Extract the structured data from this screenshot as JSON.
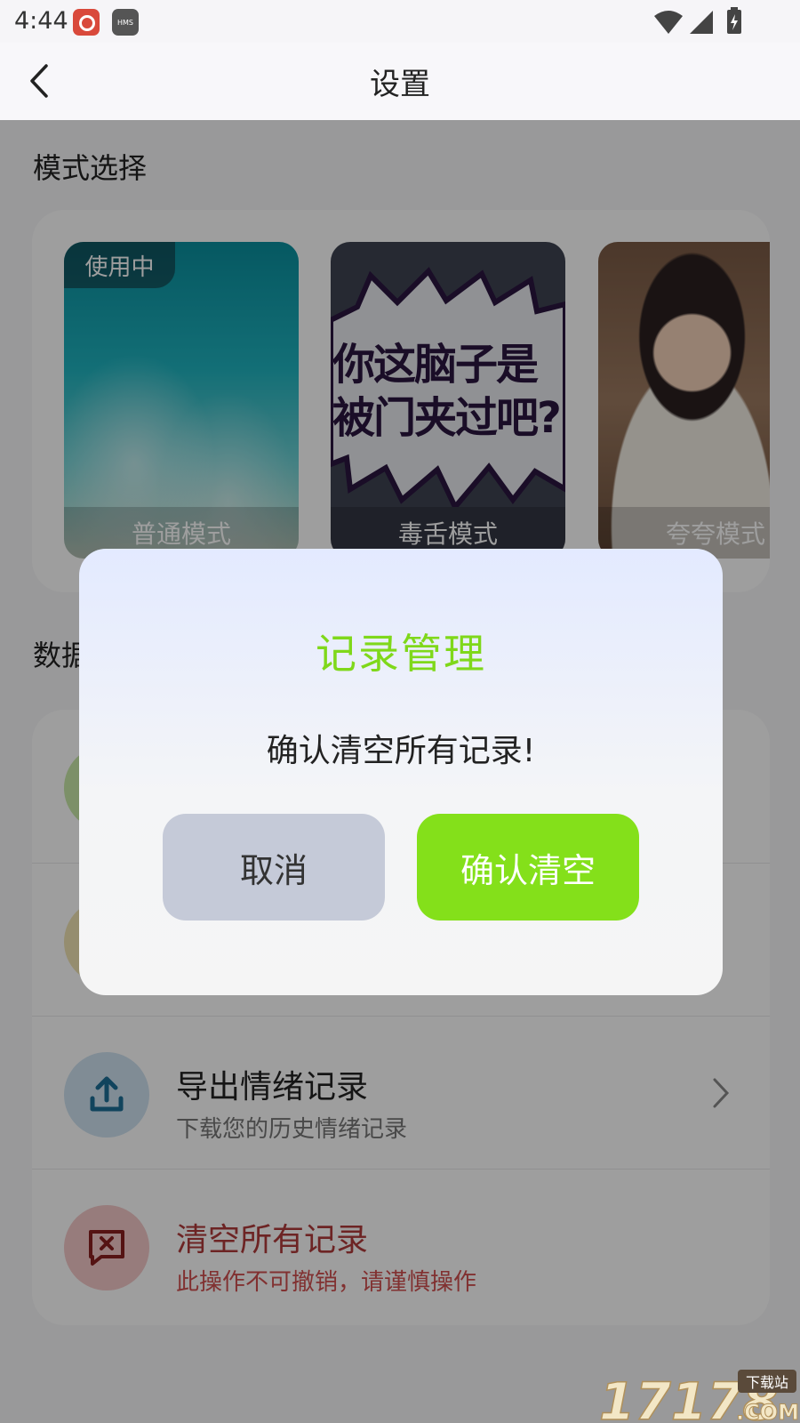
{
  "status_bar": {
    "time": "4:44",
    "app_badge": "HMS"
  },
  "header": {
    "title": "设置"
  },
  "mode_section": {
    "title": "模式选择",
    "in_use_badge": "使用中",
    "cards": [
      {
        "label": "普通模式"
      },
      {
        "label": "毒舌模式",
        "image_text_line1": "你这脑子是",
        "image_text_line2": "被门夹过吧?"
      },
      {
        "label": "夸夸模式"
      }
    ]
  },
  "data_section": {
    "title": "数据管理",
    "rows": [
      {
        "title": "",
        "subtitle": ""
      },
      {
        "title": "",
        "subtitle": ""
      },
      {
        "title": "导出情绪记录",
        "subtitle": "下载您的历史情绪记录"
      },
      {
        "title": "清空所有记录",
        "subtitle": "此操作不可撤销，请谨慎操作"
      }
    ]
  },
  "dialog": {
    "title": "记录管理",
    "message": "确认清空所有记录!",
    "cancel_label": "取消",
    "confirm_label": "确认清空"
  },
  "watermark": {
    "number": "17178",
    "tag": "下载站",
    "domain": ".COM"
  },
  "colors": {
    "accent_green": "#84e01a",
    "title_green": "#7fd81a",
    "cancel_gray": "#c5cad8",
    "danger_red": "#b03b3b"
  },
  "icons": {
    "back": "chevron-left-icon",
    "export": "upload-icon",
    "clear": "message-x-icon",
    "chevron": "chevron-right-icon"
  }
}
